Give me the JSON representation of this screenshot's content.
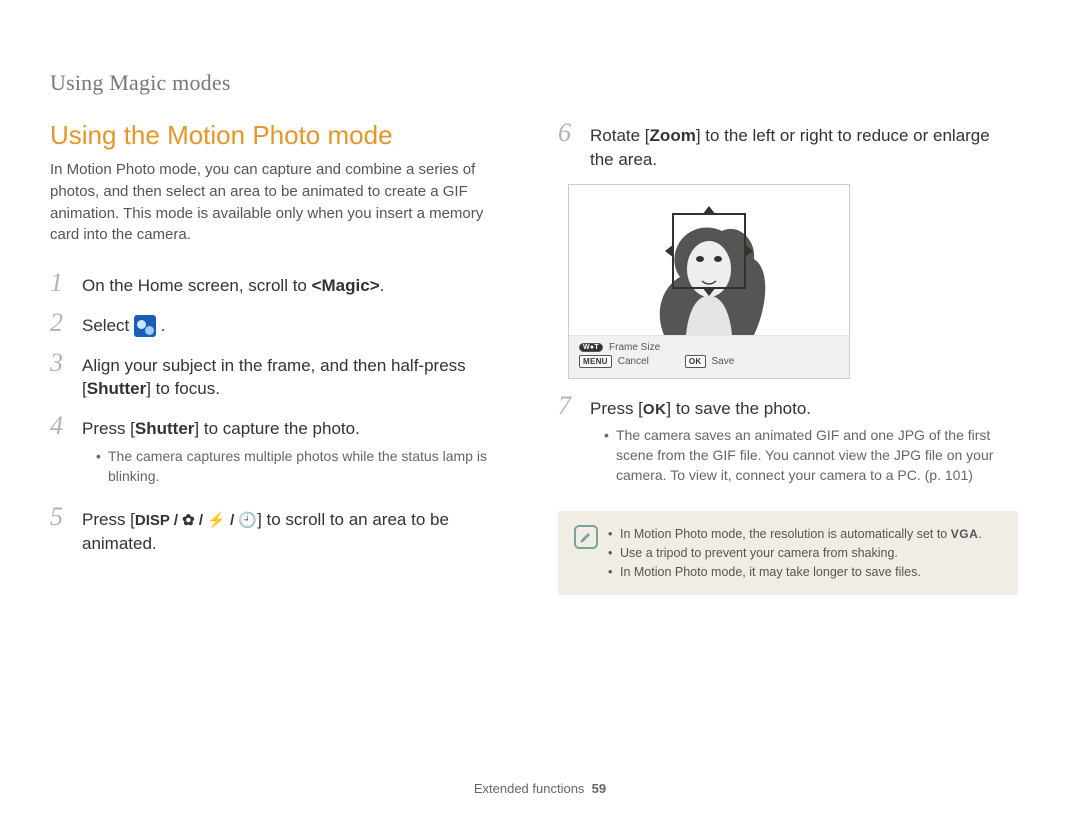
{
  "header": {
    "breadcrumb": "Using Magic modes"
  },
  "left": {
    "title": "Using the Motion Photo mode",
    "intro": "In Motion Photo mode, you can capture and combine a series of photos, and then select an area to be animated to create a GIF animation. This mode is available only when you insert a memory card into the camera.",
    "steps": {
      "s1": {
        "num": "1",
        "pre": "On the Home screen, scroll to ",
        "bold": "<Magic>",
        "post": "."
      },
      "s2": {
        "num": "2",
        "pre": "Select ",
        "post": "."
      },
      "s3": {
        "num": "3",
        "pre": "Align your subject in the frame, and then half-press [",
        "bold": "Shutter",
        "post": "] to focus."
      },
      "s4": {
        "num": "4",
        "pre": "Press [",
        "bold": "Shutter",
        "post": "] to capture the photo.",
        "sub1": "The camera captures multiple photos while the status lamp is blinking."
      },
      "s5": {
        "num": "5",
        "pre": "Press [",
        "glyphs": "DISP / ✿ / ⚡ / 🕘",
        "post": "] to scroll to an area to be animated."
      }
    }
  },
  "right": {
    "steps": {
      "s6": {
        "num": "6",
        "pre": "Rotate [",
        "bold": "Zoom",
        "post": "] to the left or right to reduce or enlarge the area."
      },
      "s7": {
        "num": "7",
        "pre": "Press [",
        "ok": "OK",
        "post": "] to save the photo.",
        "sub1": "The camera saves an animated GIF and one JPG of the first scene from the GIF file. You cannot view the JPG file on your camera. To view it, connect your camera to a PC. (p. 101)"
      }
    },
    "frame": {
      "row1": "Frame Size",
      "menu_badge": "MENU",
      "cancel": "Cancel",
      "ok_badge": "OK",
      "save": "Save",
      "wt_badge": "W●T"
    },
    "notes": {
      "n1_pre": "In Motion Photo mode, the resolution is automatically set to ",
      "n1_post": ".",
      "vga": "VGA",
      "n2": "Use a tripod to prevent your camera from shaking.",
      "n3": "In Motion Photo mode, it may take longer to save files."
    }
  },
  "footer": {
    "section": "Extended functions",
    "page": "59"
  }
}
